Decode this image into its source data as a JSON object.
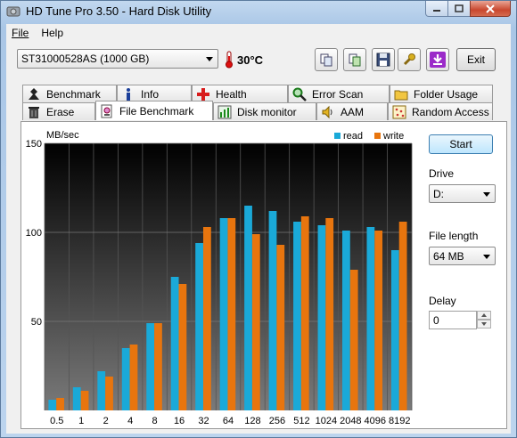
{
  "window": {
    "title": "HD Tune Pro 3.50 - Hard Disk Utility"
  },
  "menu": {
    "file": "File",
    "help": "Help"
  },
  "toolbar": {
    "drive": "ST31000528AS (1000 GB)",
    "temperature": "30°C",
    "exit_label": "Exit"
  },
  "tabs": {
    "top": [
      "Benchmark",
      "Info",
      "Health",
      "Error Scan",
      "Folder Usage"
    ],
    "bottom": [
      "Erase",
      "File Benchmark",
      "Disk monitor",
      "AAM",
      "Random Access"
    ],
    "active": "File Benchmark"
  },
  "side": {
    "start_label": "Start",
    "drive_label": "Drive",
    "drive_value": "D:",
    "file_length_label": "File length",
    "file_length_value": "64 MB",
    "delay_label": "Delay",
    "delay_value": "0"
  },
  "colors": {
    "read": "#1aa9d8",
    "write": "#e8750e",
    "plot_bg_top": "#000000",
    "plot_bg_bottom": "#7a7a7a"
  },
  "chart_data": {
    "type": "bar",
    "ylabel": "MB/sec",
    "ylim": [
      0,
      150
    ],
    "yticks": [
      50,
      100,
      150
    ],
    "categories": [
      "0.5",
      "1",
      "2",
      "4",
      "8",
      "16",
      "32",
      "64",
      "128",
      "256",
      "512",
      "1024",
      "2048",
      "4096",
      "8192"
    ],
    "series": [
      {
        "name": "read",
        "values": [
          6,
          13,
          22,
          35,
          49,
          75,
          94,
          108,
          115,
          112,
          106,
          104,
          101,
          103,
          90
        ]
      },
      {
        "name": "write",
        "values": [
          7,
          11,
          19,
          37,
          49,
          71,
          103,
          108,
          99,
          93,
          109,
          108,
          79,
          101,
          106
        ]
      }
    ],
    "legend": "top-right",
    "grid": true
  }
}
